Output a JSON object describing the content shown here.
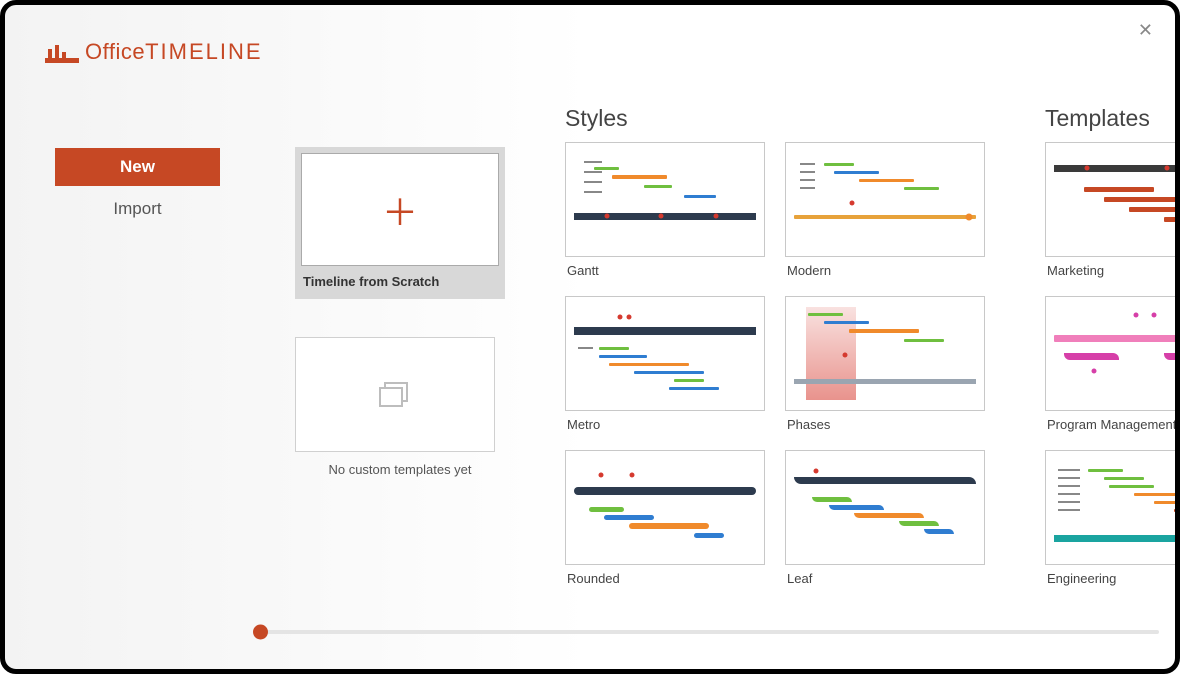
{
  "app": {
    "brand_prefix": "Office",
    "brand_suffix": "TIMELINE"
  },
  "sidebar": {
    "items": [
      {
        "label": "New",
        "active": true
      },
      {
        "label": "Import",
        "active": false
      }
    ]
  },
  "scratch": {
    "label": "Timeline from Scratch"
  },
  "custom": {
    "empty_label": "No custom templates yet"
  },
  "sections": {
    "styles_title": "Styles",
    "templates_title": "Templates"
  },
  "styles": [
    {
      "label": "Gantt"
    },
    {
      "label": "Modern"
    },
    {
      "label": "Metro"
    },
    {
      "label": "Phases"
    },
    {
      "label": "Rounded"
    },
    {
      "label": "Leaf"
    }
  ],
  "templates": [
    {
      "label": "Marketing"
    },
    {
      "label": "Program Management"
    },
    {
      "label": "Engineering"
    }
  ],
  "colors": {
    "accent": "#c64824",
    "navy": "#2d3b4e",
    "green": "#6fbf3f",
    "orange": "#f08a2b",
    "blue": "#2f7dd1",
    "red": "#d53a2f",
    "magenta": "#d63fa8",
    "pink": "#f07fbb",
    "teal": "#1aa4a0"
  }
}
